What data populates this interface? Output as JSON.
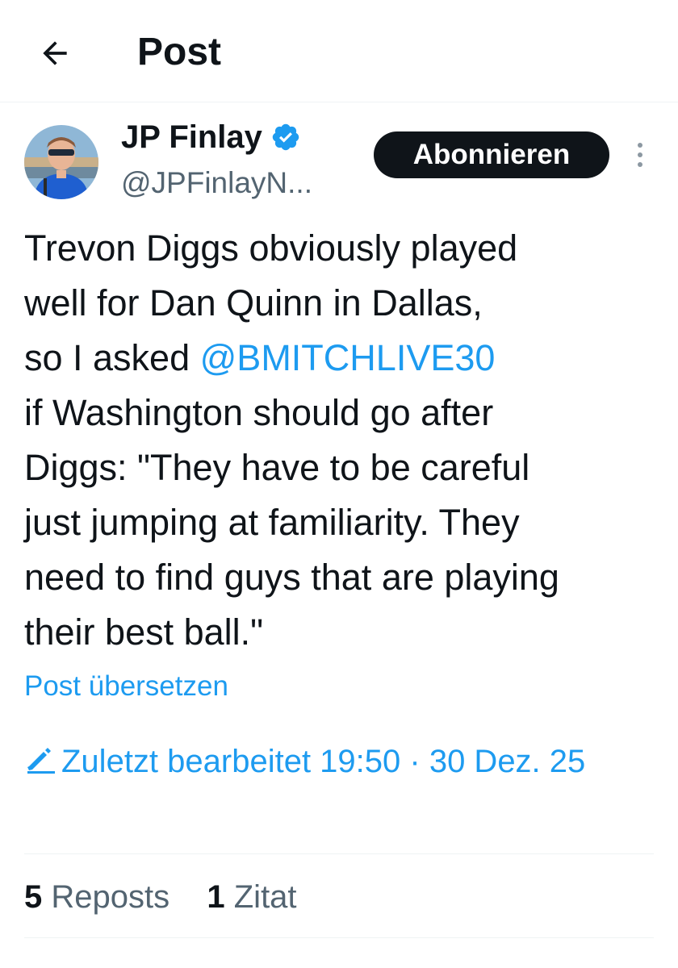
{
  "header": {
    "title": "Post"
  },
  "author": {
    "name": "JP Finlay",
    "handle": "@JPFinlayN..."
  },
  "subscribe_label": "Abonnieren",
  "post": {
    "text_before": "Trevon Diggs obviously played\nwell for Dan Quinn in Dallas,\nso I asked ",
    "mention": "@BMITCHLIVE30",
    "text_after": "\nif Washington should go after\nDiggs: \"They have to be careful\njust jumping at familiarity. They\nneed to find guys that are playing\ntheir best ball.\""
  },
  "translate_label": "Post übersetzen",
  "edited_label": "Zuletzt bearbeitet 19:50 · 30 Dez. 25",
  "stats": {
    "reposts_count": "5",
    "reposts_label": "Reposts",
    "quotes_count": "1",
    "quotes_label": "Zitat"
  },
  "colors": {
    "accent": "#1d9bf0",
    "text": "#0f1419",
    "secondary": "#536471"
  },
  "icons": {
    "back": "arrow-left-icon",
    "verified": "verified-badge-icon",
    "more": "more-vertical-icon",
    "edited": "pencil-icon"
  }
}
